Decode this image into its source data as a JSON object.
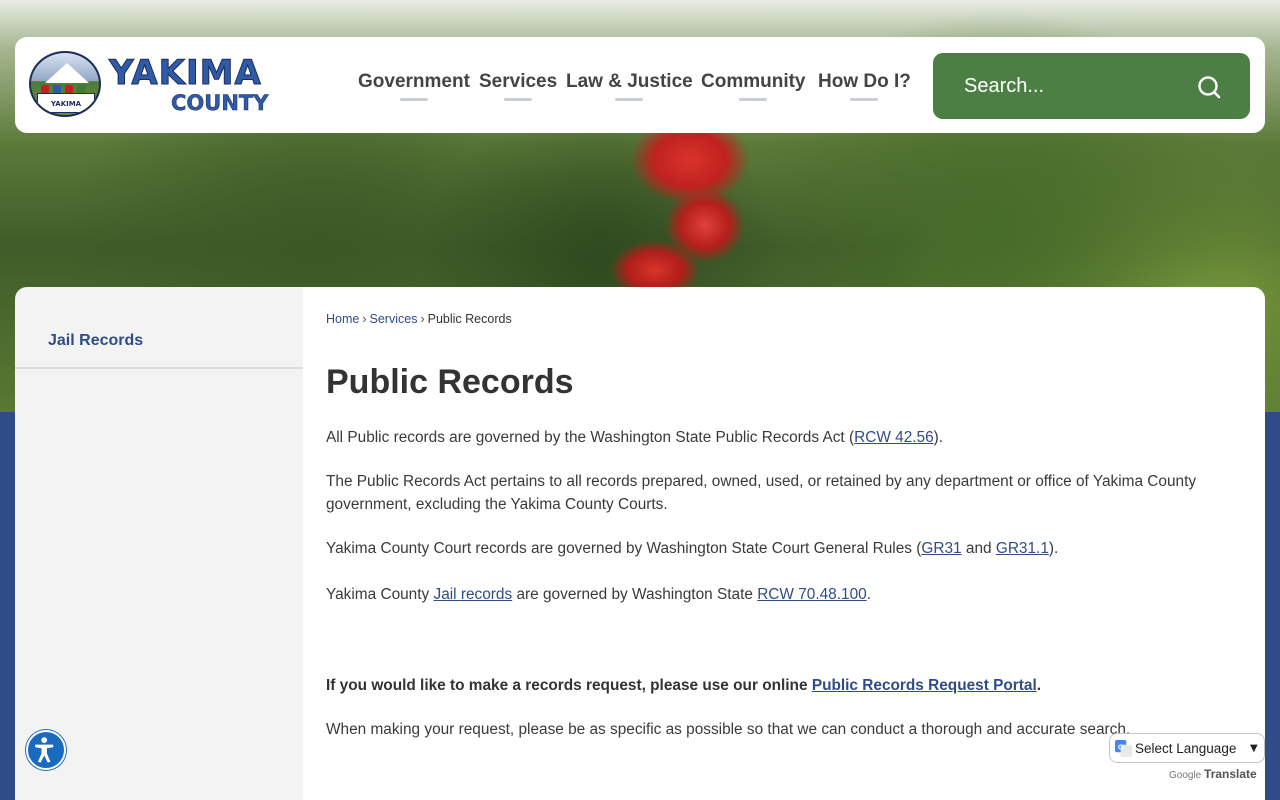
{
  "header": {
    "logo_line1": "YAKIMA",
    "logo_line2": "COUNTY",
    "seal_text": "YAKIMA",
    "nav": [
      {
        "label": "Government"
      },
      {
        "label": "Services"
      },
      {
        "label": "Law & Justice"
      },
      {
        "label": "Community"
      },
      {
        "label": "How Do I?"
      }
    ],
    "search": {
      "placeholder": "Search..."
    }
  },
  "sidebar": {
    "items": [
      {
        "label": "Jail Records"
      }
    ]
  },
  "breadcrumb": {
    "items": [
      "Home",
      "Services"
    ],
    "current": "Public Records",
    "separator": "›"
  },
  "main": {
    "title": "Public Records",
    "p1": {
      "text": "All Public records are governed by the Washington State Public Records Act (",
      "link": "RCW 42.56",
      "end": ")."
    },
    "p2": {
      "text": "The Public Records Act pertains to all records prepared, owned, used, or retained by any department or office of Yakima County government, excluding the Yakima County Courts."
    },
    "p3": {
      "text": "Yakima County Court records are governed by Washington State Court General Rules (",
      "link1": "GR31",
      "mid": " and ",
      "link2": "GR31.1",
      "end": ")."
    },
    "p4": {
      "text": "Yakima County ",
      "link1": "Jail records",
      "mid": " are governed by Washington State ",
      "link2": "RCW 70.48.100",
      "end": "."
    },
    "p5": {
      "text": "If you would like to make a records request, please use our online ",
      "link": "Public Records Request Portal",
      "end": "."
    },
    "p6": {
      "text": "When making your request, please be as specific as possible so that we can conduct a thorough and accurate search."
    }
  },
  "translate": {
    "select_label": "Select Language",
    "powered_by": "Google",
    "translate_word": "Translate"
  },
  "colors": {
    "brand_blue": "#2f4c87",
    "search_green": "#4c7f44",
    "accessibility_blue": "#1a6ac0"
  }
}
